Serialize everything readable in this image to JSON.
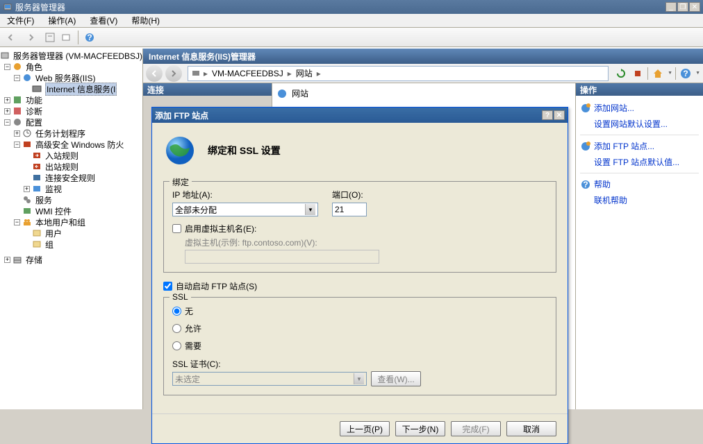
{
  "window": {
    "title": "服务器管理器"
  },
  "menubar": [
    "文件(F)",
    "操作(A)",
    "查看(V)",
    "帮助(H)"
  ],
  "tree": {
    "root": "服务器管理器 (VM-MACFEEDBSJ)",
    "roles": "角色",
    "web_server": "Web 服务器(IIS)",
    "iis": "Internet 信息服务(I",
    "features": "功能",
    "diagnostics": "诊断",
    "config": "配置",
    "task_scheduler": "任务计划程序",
    "firewall": "高级安全 Windows 防火",
    "inbound": "入站规则",
    "outbound": "出站规则",
    "conn_security": "连接安全规则",
    "monitor": "监视",
    "services": "服务",
    "wmi": "WMI 控件",
    "local_users": "本地用户和组",
    "users": "用户",
    "groups": "组",
    "storage": "存储"
  },
  "iis": {
    "header": "Internet 信息服务(IIS)管理器",
    "breadcrumb_host": "VM-MACFEEDBSJ",
    "breadcrumb_sites": "网站",
    "connections_header": "连接",
    "sites_label": "网站",
    "actions_header": "操作"
  },
  "actions": {
    "add_website": "添加网站...",
    "set_defaults": "设置网站默认设置...",
    "add_ftp_site": "添加 FTP 站点...",
    "set_ftp_defaults": "设置 FTP 站点默认值...",
    "help": "帮助",
    "online_help": "联机帮助"
  },
  "dialog": {
    "title": "添加 FTP 站点",
    "subtitle": "绑定和 SSL 设置",
    "binding_legend": "绑定",
    "ip_label": "IP 地址(A):",
    "ip_value": "全部未分配",
    "port_label": "端口(O):",
    "port_value": "21",
    "enable_vhost": "启用虚拟主机名(E):",
    "vhost_label": "虚拟主机(示例: ftp.contoso.com)(V):",
    "auto_start": "自动启动 FTP 站点(S)",
    "ssl_legend": "SSL",
    "ssl_none": "无",
    "ssl_allow": "允许",
    "ssl_require": "需要",
    "ssl_cert_label": "SSL 证书(C):",
    "ssl_cert_value": "未选定",
    "view_btn": "查看(W)...",
    "prev_btn": "上一页(P)",
    "next_btn": "下一步(N)",
    "finish_btn": "完成(F)",
    "cancel_btn": "取消"
  }
}
